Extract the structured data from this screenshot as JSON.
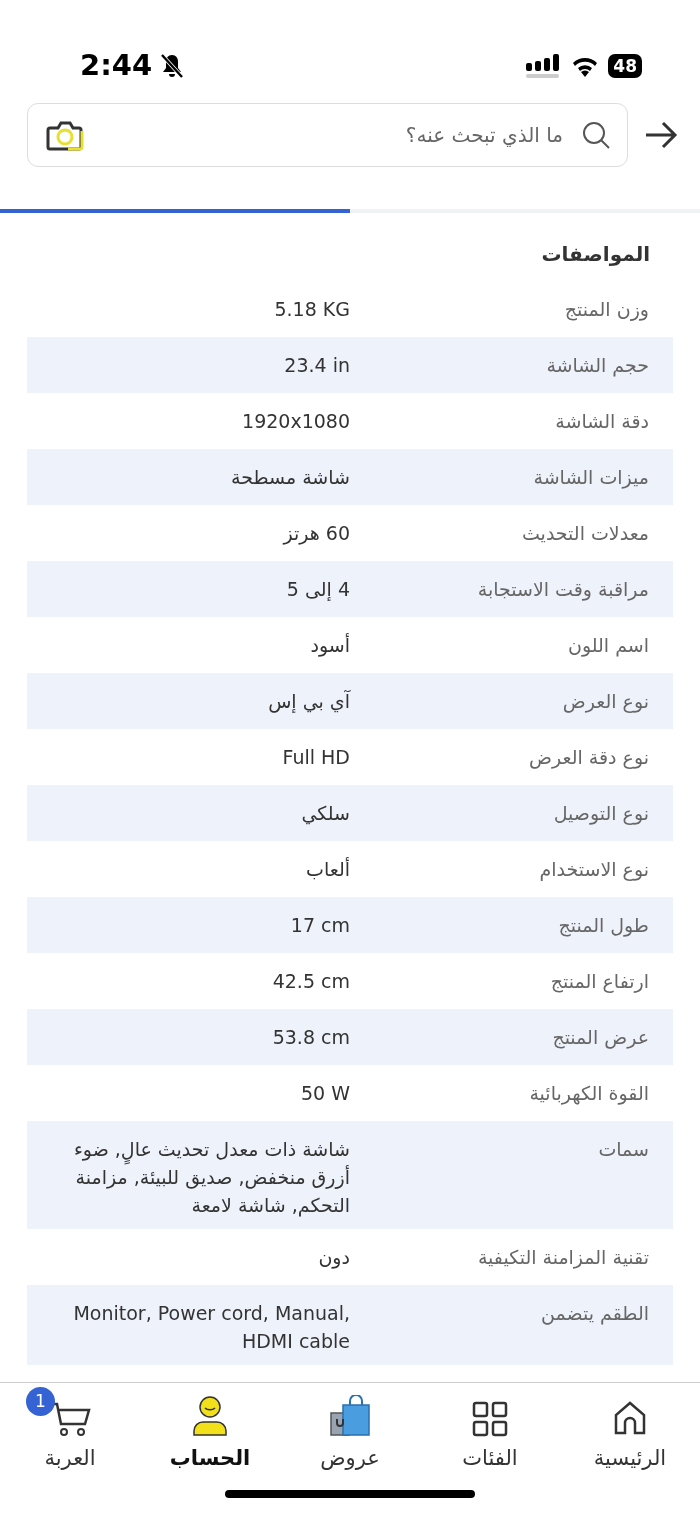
{
  "status_bar": {
    "time": "2:44",
    "silent": true,
    "battery": "48"
  },
  "search": {
    "placeholder": "ما الذي تبحث عنه؟"
  },
  "tabs": [
    {
      "selected": false
    },
    {
      "selected": true
    }
  ],
  "specs": {
    "title": "المواصفات",
    "rows": [
      {
        "label": "وزن المنتج",
        "value": "5.18 KG"
      },
      {
        "label": "حجم الشاشة",
        "value": "23.4 in"
      },
      {
        "label": "دقة الشاشة",
        "value": "1920x1080"
      },
      {
        "label": "ميزات الشاشة",
        "value": "شاشة مسطحة"
      },
      {
        "label": "معدلات التحديث",
        "value": "60 هرتز"
      },
      {
        "label": "مراقبة وقت الاستجابة",
        "value": "4 إلى 5"
      },
      {
        "label": "اسم اللون",
        "value": "أسود"
      },
      {
        "label": "نوع العرض",
        "value": "آي بي إس"
      },
      {
        "label": "نوع دقة العرض",
        "value": "Full HD"
      },
      {
        "label": "نوع التوصيل",
        "value": "سلكي"
      },
      {
        "label": "نوع الاستخدام",
        "value": "ألعاب"
      },
      {
        "label": "طول المنتج",
        "value": "17 cm"
      },
      {
        "label": "ارتفاع المنتج",
        "value": "42.5 cm"
      },
      {
        "label": "عرض المنتج",
        "value": "53.8 cm"
      },
      {
        "label": "القوة الكهربائية",
        "value": "50 W"
      },
      {
        "label": "سمات",
        "value": "شاشة ذات معدل تحديث عالٍ, ضوء أزرق منخفض, صديق للبيئة, مزامنة التحكم, شاشة لامعة"
      },
      {
        "label": "تقنية المزامنة التكيفية",
        "value": "دون"
      },
      {
        "label": "الطقم يتضمن",
        "value": "Monitor, Power cord, Manual, HDMI cable"
      }
    ]
  },
  "bottom_nav": [
    {
      "kind": "home",
      "label": "الرئيسية",
      "selected": false
    },
    {
      "kind": "categories",
      "label": "الفئات",
      "selected": false
    },
    {
      "kind": "offers",
      "label": "عروض",
      "selected": false
    },
    {
      "kind": "account",
      "label": "الحساب",
      "selected": true
    },
    {
      "kind": "cart",
      "label": "العربة",
      "selected": false,
      "badge": "1"
    }
  ]
}
